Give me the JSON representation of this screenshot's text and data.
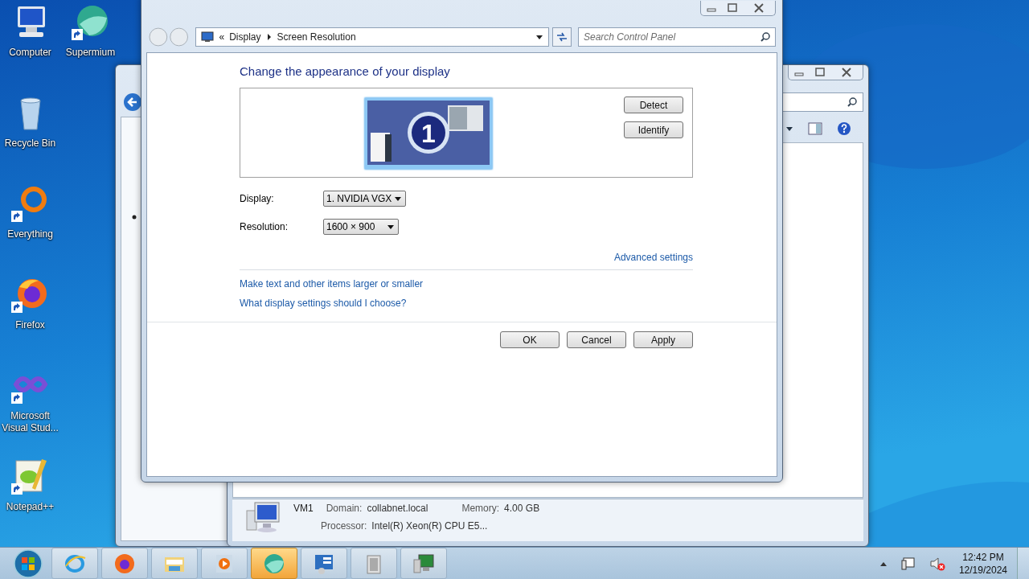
{
  "desktop_icons": [
    {
      "label": "Computer",
      "kind": "computer",
      "shortcut": false
    },
    {
      "label": "Supermium",
      "kind": "supermium",
      "shortcut": true
    },
    {
      "label": "Recycle Bin",
      "kind": "recycle",
      "shortcut": false
    },
    {
      "label": "Everything",
      "kind": "everything",
      "shortcut": true
    },
    {
      "label": "Firefox",
      "kind": "firefox",
      "shortcut": true
    },
    {
      "label": "Microsoft Visual Stud...",
      "kind": "vstudio",
      "shortcut": true
    },
    {
      "label": "Notepad++",
      "kind": "notepad",
      "shortcut": true
    }
  ],
  "back_window": {
    "details": {
      "name": "VM1",
      "domain_label": "Domain:",
      "domain": "collabnet.local",
      "memory_label": "Memory:",
      "memory": "4.00 GB",
      "processor_label": "Processor:",
      "processor": "Intel(R) Xeon(R) CPU E5..."
    }
  },
  "dialog": {
    "breadcrumb": {
      "prefix": "«",
      "items": [
        "Display",
        "Screen Resolution"
      ]
    },
    "search": {
      "placeholder": "Search Control Panel"
    },
    "heading": "Change the appearance of your display",
    "monitor": {
      "number": "1",
      "selected": true
    },
    "preview_buttons": [
      "Detect",
      "Identify"
    ],
    "fields": [
      {
        "label": "Display:",
        "value": "1. NVIDIA VGX"
      },
      {
        "label": "Resolution:",
        "value": "1600 × 900"
      }
    ],
    "advanced_link": "Advanced settings",
    "links": [
      "Make text and other items larger or smaller",
      "What display settings should I choose?"
    ],
    "buttons": [
      "OK",
      "Cancel",
      "Apply"
    ]
  },
  "taskbar": {
    "items": [
      {
        "kind": "ie",
        "selected": false
      },
      {
        "kind": "firefox",
        "selected": false
      },
      {
        "kind": "explorer",
        "selected": false
      },
      {
        "kind": "media",
        "selected": false
      },
      {
        "kind": "supermium",
        "selected": true
      },
      {
        "kind": "control",
        "selected": false
      },
      {
        "kind": "files",
        "selected": false
      },
      {
        "kind": "computer",
        "selected": false
      }
    ],
    "time": "12:42 PM",
    "date": "12/19/2024"
  }
}
